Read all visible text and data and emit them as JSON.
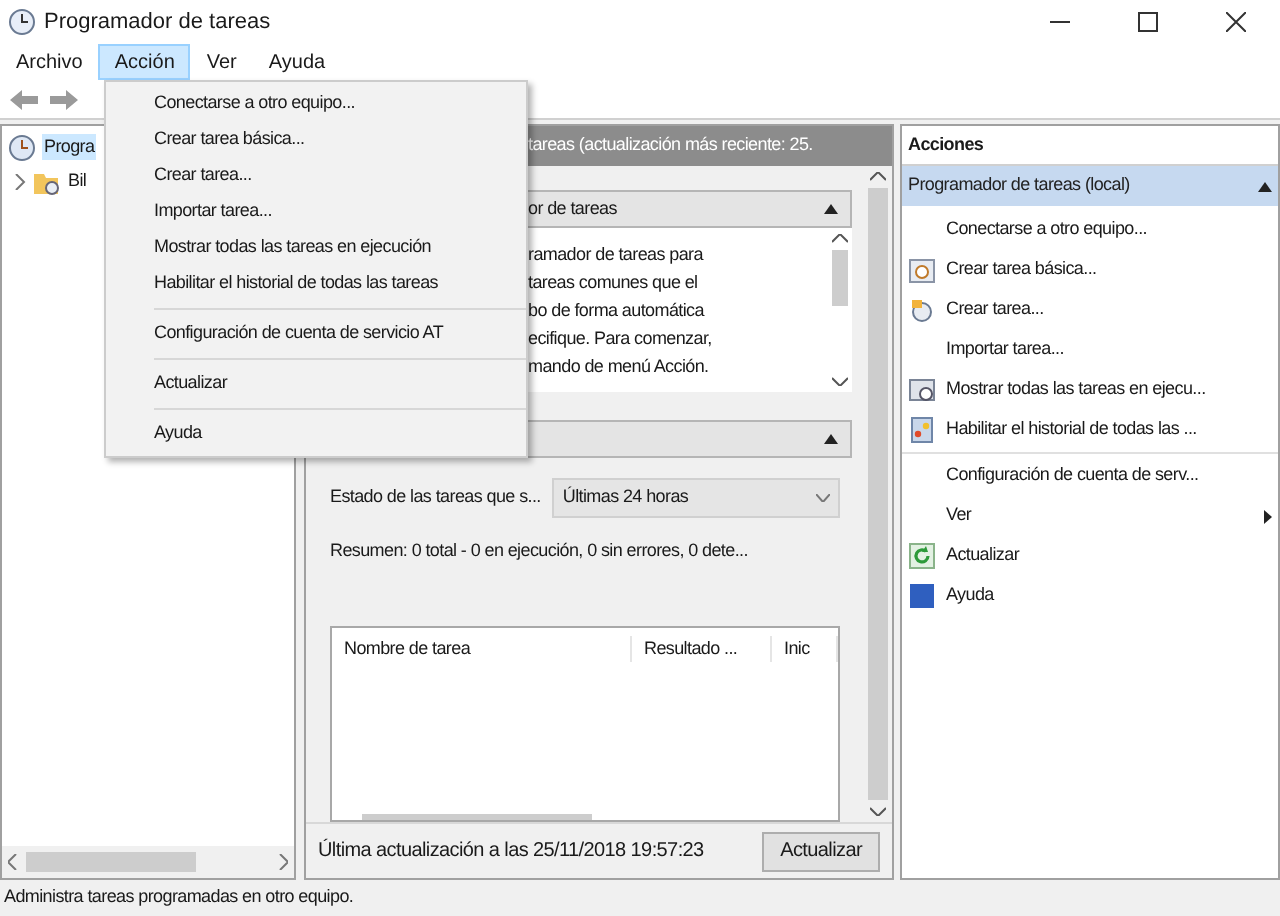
{
  "window": {
    "title": "Programador de tareas"
  },
  "menu_bar": [
    {
      "label": "Archivo",
      "selected": false
    },
    {
      "label": "Acción",
      "selected": true
    },
    {
      "label": "Ver",
      "selected": false
    },
    {
      "label": "Ayuda",
      "selected": false
    }
  ],
  "dropdown_menu": [
    {
      "label": "Conectarse a otro equipo...",
      "separator_before": false
    },
    {
      "label": "Crear tarea básica...",
      "separator_before": false
    },
    {
      "label": "Crear tarea...",
      "separator_before": false
    },
    {
      "label": "Importar tarea...",
      "separator_before": false
    },
    {
      "label": "Mostrar todas las tareas en ejecución",
      "separator_before": false
    },
    {
      "label": "Habilitar el historial de todas las tareas",
      "separator_before": false
    },
    {
      "label": "Configuración de cuenta de servicio AT",
      "separator_before": true
    },
    {
      "label": "Actualizar",
      "separator_before": true
    },
    {
      "label": "Ayuda",
      "separator_before": true
    }
  ],
  "tree": [
    {
      "label": "Progra",
      "selected": true,
      "children": [
        {
          "label": "Bil",
          "selected": false,
          "expanded": false
        }
      ]
    }
  ],
  "center": {
    "header": "tareas (actualización más reciente: 25.",
    "section_1": {
      "title": "or de tareas",
      "expanded": true,
      "lines": [
        "ramador de tareas para",
        "tareas comunes que el",
        "bo de forma automática",
        "ecifique. Para comenzar,",
        "mando de menú Acción."
      ]
    },
    "section_2": {
      "expanded": true,
      "status_label": "Estado de las tareas que s...",
      "status_filter": "Últimas 24 horas",
      "summary": "Resumen: 0 total - 0 en ejecución, 0 sin errores, 0 dete...",
      "table": {
        "columns": [
          "Nombre de tarea",
          "Resultado ...",
          "Inic"
        ]
      }
    },
    "last_update": "Última actualización a las 25/11/2018 19:57:23",
    "refresh_button": "Actualizar"
  },
  "actions": {
    "title": "Acciones",
    "group": {
      "label": "Programador de tareas (local)",
      "expanded": true
    },
    "items": [
      {
        "label": "Conectarse a otro equipo...",
        "separator_before": false,
        "submenu": false
      },
      {
        "label": "Crear tarea básica...",
        "separator_before": false,
        "submenu": false
      },
      {
        "label": "Crear tarea...",
        "separator_before": false,
        "submenu": false
      },
      {
        "label": "Importar tarea...",
        "separator_before": false,
        "submenu": false
      },
      {
        "label": "Mostrar todas las tareas en ejecu...",
        "separator_before": false,
        "submenu": false
      },
      {
        "label": "Habilitar el historial de todas las ...",
        "separator_before": false,
        "submenu": false
      },
      {
        "label": "Configuración de cuenta de serv...",
        "separator_before": true,
        "submenu": false
      },
      {
        "label": "Ver",
        "separator_before": false,
        "submenu": true
      },
      {
        "label": "Actualizar",
        "separator_before": false,
        "submenu": false
      },
      {
        "label": "Ayuda",
        "separator_before": false,
        "submenu": false
      }
    ]
  },
  "status_bar": "Administra tareas programadas en otro equipo."
}
